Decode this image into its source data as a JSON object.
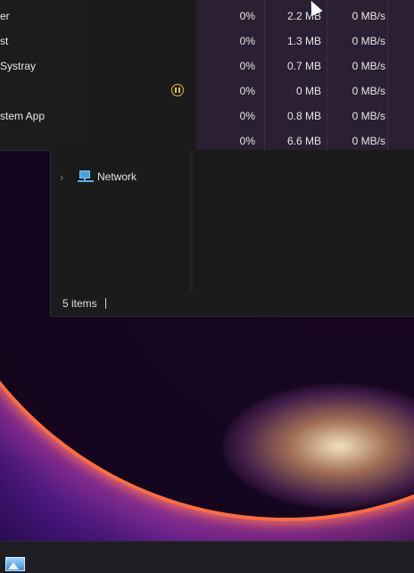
{
  "task_manager": {
    "rows": [
      {
        "name": "er",
        "cpu": "0%",
        "memory": "2.2 MB",
        "disk": "0 MB/s",
        "status_icon": ""
      },
      {
        "name": "st",
        "cpu": "0%",
        "memory": "1.3 MB",
        "disk": "0 MB/s",
        "status_icon": ""
      },
      {
        "name": "Systray",
        "cpu": "0%",
        "memory": "0.7 MB",
        "disk": "0 MB/s",
        "status_icon": ""
      },
      {
        "name": "",
        "cpu": "0%",
        "memory": "0 MB",
        "disk": "0 MB/s",
        "status_icon": "pause-icon"
      },
      {
        "name": "stem App",
        "cpu": "0%",
        "memory": "0.8 MB",
        "disk": "0 MB/s",
        "status_icon": ""
      },
      {
        "name": "",
        "cpu": "0%",
        "memory": "6.6 MB",
        "disk": "0 MB/s",
        "status_icon": ""
      }
    ]
  },
  "explorer": {
    "nav_items": [
      {
        "label": "Network",
        "icon": "network-icon",
        "expand_icon": "chevron-right-icon"
      }
    ],
    "status_bar": {
      "item_count": "5 items"
    }
  },
  "taskbar": {
    "apps": [
      {
        "icon": "photos-app-icon"
      }
    ]
  },
  "colors": {
    "task_manager_highlight": "#2a1f33",
    "paused_status": "#e2c12f",
    "window_bg": "#1b1b1b"
  }
}
